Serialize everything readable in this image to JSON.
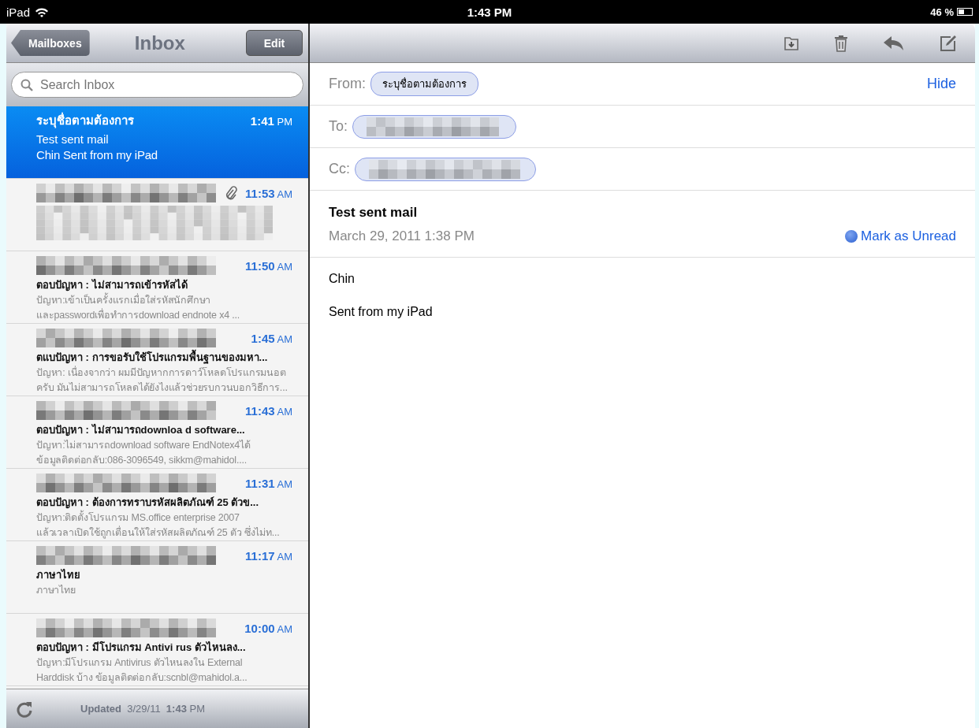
{
  "status_bar": {
    "device": "iPad",
    "time": "1:43 PM",
    "battery_percent": "46 %"
  },
  "sidebar": {
    "back_button": "Mailboxes",
    "title": "Inbox",
    "edit_button": "Edit",
    "search": {
      "placeholder": "Search Inbox"
    },
    "messages": [
      {
        "sender": "ระบุชื่อตามต้องการ",
        "time": "1:41",
        "meridiem": "PM",
        "subject": "Test sent mail",
        "preview": [
          "Chin Sent from my iPad"
        ],
        "selected": true,
        "attachment": false
      },
      {
        "time": "11:53",
        "meridiem": "AM",
        "selected": false,
        "attachment": true
      },
      {
        "time": "11:50",
        "meridiem": "AM",
        "subject": "ตอบปัญหา : ไม่สามารถเข้ารหัสได้",
        "preview": [
          "ปัญหา:เข้าเป็นครั้งแรกเมื่อใส่รหัสนักศึกษา",
          "และpasswordเพื่อทำการdownload endnote x4 ..."
        ],
        "selected": false,
        "attachment": false
      },
      {
        "time": "1:45",
        "meridiem": "AM",
        "subject": "ตแบปัญหา : การขอรับใช้โปรแกรมพื้นฐานของมหา...",
        "preview": [
          "ปัญหา: เนื่องจากว่า ผมมีปัญหากการดาว์โหลดโปรแกรมนอต",
          "ครับ มันไม่สามารถโหลดได้ยังไงแล้วช่วยรบกวนบอกวิธีการ..."
        ],
        "selected": false,
        "attachment": false
      },
      {
        "time": "11:43",
        "meridiem": "AM",
        "subject": "ตอบปัญหา : ไม่สามารถdownloa d software...",
        "preview": [
          "ปัญหา:ไม่สามารถdownload software EndNotex4ได้",
          "ข้อมูลติดต่อกลับ:086-3096549, sikkm@mahidol...."
        ],
        "selected": false,
        "attachment": false
      },
      {
        "time": "11:31",
        "meridiem": "AM",
        "subject": "ตอบปัญหา : ต้องการทราบรหัสผลิตภัณฑ์ 25 ตัวข...",
        "preview": [
          "ปัญหา:ติดตั้งโปรแกรม MS.office enterprise 2007",
          "แล้วเวลาเปิดใช้ถูกเตื่อนให้ใส่รหัสผลิตภัณฑ์ 25 ตัว ซึ่งไม่ท..."
        ],
        "selected": false,
        "attachment": false
      },
      {
        "time": "11:17",
        "meridiem": "AM",
        "subject": "ภาษาไทย",
        "preview": [
          "ภาษาไทย"
        ],
        "selected": false,
        "attachment": false
      },
      {
        "time": "10:00",
        "meridiem": "AM",
        "subject": "ตอบปัญหา : มีโปรแกรม Antivi rus  ตัวไหนลง...",
        "preview": [
          "ปัญหา:มีโปรแกรม Antivirus ตัวไหนลงใน External",
          "Harddisk บ้าง ข้อมูลติดต่อกลับ:scnbl@mahidol.a..."
        ],
        "selected": false,
        "attachment": false
      }
    ],
    "footer": {
      "label": "Updated",
      "date": "3/29/11",
      "time": "1:43",
      "meridiem": "PM"
    }
  },
  "message": {
    "from_label": "From:",
    "from": "ระบุชื่อตามต้องการ",
    "hide": "Hide",
    "to_label": "To:",
    "cc_label": "Cc:",
    "subject": "Test sent mail",
    "date": "March 29, 2011 1:38 PM",
    "mark_unread": "Mark as Unread",
    "body": [
      "Chin",
      "Sent from my iPad"
    ]
  }
}
